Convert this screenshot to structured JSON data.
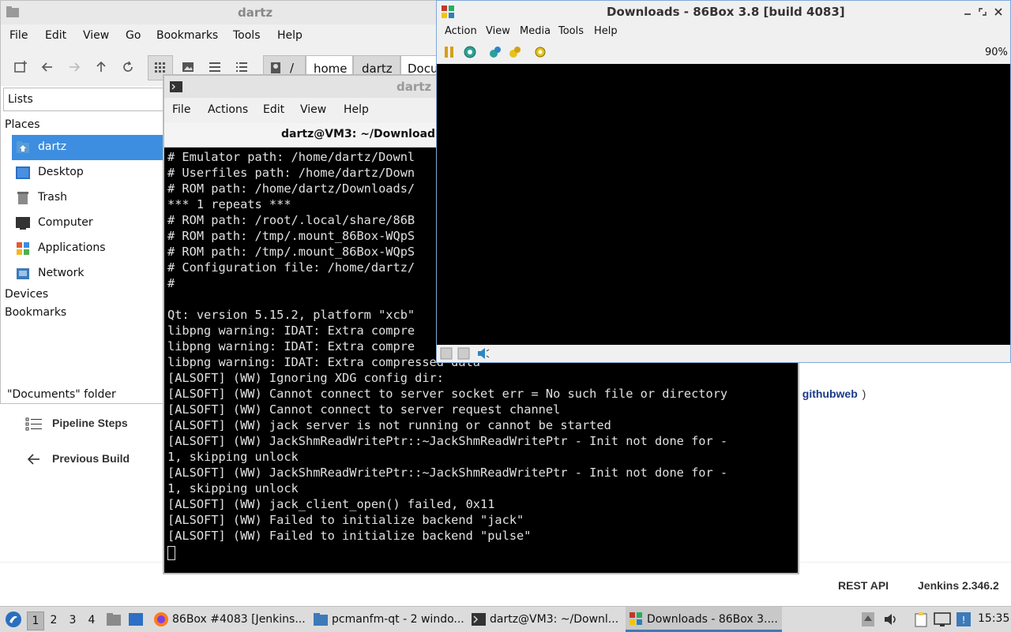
{
  "jenkins": {
    "sidebar": [
      {
        "label": "Pipeline Steps",
        "icon": "list-icon"
      },
      {
        "label": "Previous Build",
        "icon": "arrow-left-icon"
      }
    ],
    "breadcrumb_tail": "/ githubweb)",
    "link": "githubweb",
    "footer": {
      "rest_api": "REST API",
      "version": "Jenkins 2.346.2"
    }
  },
  "file_manager": {
    "title": "dartz",
    "menu": [
      "File",
      "Edit",
      "View",
      "Go",
      "Bookmarks",
      "Tools",
      "Help"
    ],
    "path": {
      "root": "/",
      "crumbs": [
        "home",
        "dartz",
        "Docu"
      ]
    },
    "view_mode": "Lists",
    "sections": {
      "places": "Places",
      "devices": "Devices",
      "bookmarks": "Bookmarks"
    },
    "places": [
      {
        "label": "dartz",
        "icon": "home-folder-icon",
        "selected": true
      },
      {
        "label": "Desktop",
        "icon": "desktop-icon"
      },
      {
        "label": "Trash",
        "icon": "trash-icon"
      },
      {
        "label": "Computer",
        "icon": "computer-icon"
      },
      {
        "label": "Applications",
        "icon": "applications-icon"
      },
      {
        "label": "Network",
        "icon": "network-icon"
      }
    ],
    "status": "\"Documents\" folder"
  },
  "terminal": {
    "title": "dartz",
    "tab_title": "dartz@VM3: ~/Downloads",
    "menu": [
      "File",
      "Actions",
      "Edit",
      "View",
      "Help"
    ],
    "lines": [
      "# Emulator path: /home/dartz/Downl",
      "# Userfiles path: /home/dartz/Down",
      "# ROM path: /home/dartz/Downloads/",
      "*** 1 repeats ***",
      "# ROM path: /root/.local/share/86B",
      "# ROM path: /tmp/.mount_86Box-WQpS",
      "# ROM path: /tmp/.mount_86Box-WQpS",
      "# Configuration file: /home/dartz/",
      "#",
      "",
      "Qt: version 5.15.2, platform \"xcb\"",
      "libpng warning: IDAT: Extra compre",
      "libpng warning: IDAT: Extra compre",
      "libpng warning: IDAT: Extra compressed data",
      "[ALSOFT] (WW) Ignoring XDG config dir:",
      "[ALSOFT] (WW) Cannot connect to server socket err = No such file or directory",
      "[ALSOFT] (WW) Cannot connect to server request channel",
      "[ALSOFT] (WW) jack server is not running or cannot be started",
      "[ALSOFT] (WW) JackShmReadWritePtr::~JackShmReadWritePtr - Init not done for -",
      "1, skipping unlock",
      "[ALSOFT] (WW) JackShmReadWritePtr::~JackShmReadWritePtr - Init not done for -",
      "1, skipping unlock",
      "[ALSOFT] (WW) jack_client_open() failed, 0x11",
      "[ALSOFT] (WW) Failed to initialize backend \"jack\"",
      "[ALSOFT] (WW) Failed to initialize backend \"pulse\""
    ]
  },
  "box86": {
    "title": "Downloads - 86Box 3.8 [build 4083]",
    "menu": [
      "Action",
      "View",
      "Media",
      "Tools",
      "Help"
    ],
    "zoom": "90%"
  },
  "taskbar": {
    "desktops": [
      "1",
      "2",
      "3",
      "4"
    ],
    "active_desktop": "1",
    "tasks": [
      {
        "label": "86Box #4083 [Jenkins...",
        "icon": "firefox-icon"
      },
      {
        "label": "pcmanfm-qt - 2 windo...",
        "icon": "folder-icon"
      },
      {
        "label": "dartz@VM3: ~/Downl...",
        "icon": "terminal-icon"
      },
      {
        "label": "Downloads - 86Box 3....",
        "icon": "86box-icon",
        "active": true
      }
    ],
    "clock": "15:35"
  }
}
